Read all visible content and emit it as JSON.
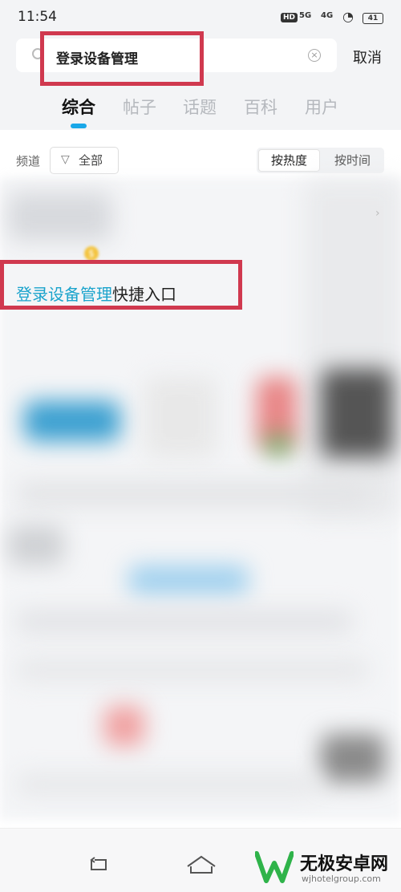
{
  "status_bar": {
    "time": "11:54",
    "hd_badge": "HD",
    "network_1": "5G",
    "network_2": "4G",
    "battery": "41"
  },
  "search": {
    "query": "登录设备管理",
    "cancel_label": "取消"
  },
  "tabs": [
    {
      "label": "综合",
      "active": true
    },
    {
      "label": "帖子",
      "active": false
    },
    {
      "label": "话题",
      "active": false
    },
    {
      "label": "百科",
      "active": false
    },
    {
      "label": "用户",
      "active": false
    }
  ],
  "filter": {
    "channel_label": "频道",
    "all_label": "全部",
    "sort_options": [
      "按热度",
      "按时间"
    ],
    "sort_selected": "按热度"
  },
  "result": {
    "title_highlight": "登录设备管理",
    "title_rest": "快捷入口"
  },
  "watermark": {
    "title": "无极安卓网",
    "url": "wjhotelgroup.com"
  },
  "colors": {
    "accent": "#19a7e8",
    "highlight_text": "#1aa3cc",
    "annotation_red": "#d0394f"
  }
}
